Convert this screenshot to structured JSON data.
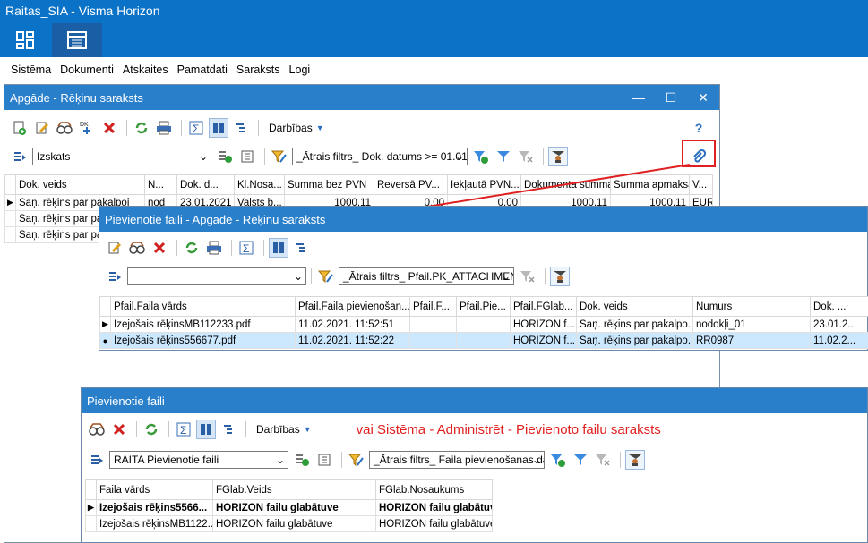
{
  "app": {
    "title": "Raitas_SIA - Visma Horizon"
  },
  "menu": [
    "Sistēma",
    "Dokumenti",
    "Atskaites",
    "Pamatdati",
    "Saraksts",
    "Logi"
  ],
  "win1": {
    "title": "Apgāde - Rēķinu saraksts",
    "darbibas": "Darbības",
    "view_combo": "Izskats",
    "quick_filter": "_Ātrais filtrs_ Dok. datums >= 01.01",
    "columns": [
      "Dok. veids",
      "N...",
      "Dok. d...",
      "Kl.Nosa...",
      "Summa bez PVN",
      "Reversā PV...",
      "Iekļautā PVN...",
      "Dokumenta summa",
      "Summa apmaksai",
      "V..."
    ],
    "rows": [
      [
        "Saņ. rēķins par pakalpoj",
        "nod",
        "23.01.2021",
        "Valsts b...",
        "1000,11",
        "0,00",
        "0,00",
        "1000,11",
        "1000,11",
        "EUR"
      ],
      [
        "Saņ. rēķins par pakalpo",
        "",
        "",
        "",
        "",
        "",
        "",
        "",
        "",
        ""
      ],
      [
        "Saņ. rēķins par pakalpo",
        "",
        "",
        "",
        "",
        "",
        "",
        "",
        "",
        ""
      ]
    ]
  },
  "win2": {
    "title": "Pievienotie faili - Apgāde - Rēķinu saraksts",
    "view_combo": "",
    "quick_filter": "_Ātrais filtrs_ Pfail.PK_ATTACHMENT",
    "columns": [
      "Pfail.Faila vārds",
      "Pfail.Faila pievienošan...",
      "Pfail.F...",
      "Pfail.Pie...",
      "Pfail.FGlab...",
      "Dok. veids",
      "Numurs",
      "Dok. ..."
    ],
    "rows": [
      [
        "Izejošais rēķinsMB112233.pdf",
        "11.02.2021. 11:52:51",
        "",
        "",
        "HORIZON f...",
        "Saņ. rēķins par pakalpo...",
        "nodokļi_01",
        "23.01.2..."
      ],
      [
        "Izejošais rēķins556677.pdf",
        "11.02.2021. 11:52:22",
        "",
        "",
        "HORIZON f...",
        "Saņ. rēķins par pakalpo...",
        "RR0987",
        "11.02.2..."
      ]
    ]
  },
  "win3": {
    "title": "Pievienotie faili",
    "darbibas": "Darbības",
    "note": "vai Sistēma - Administrēt - Pievienoto failu saraksts",
    "view_combo": "RAITA Pievienotie faili",
    "quick_filter": "_Ātrais filtrs_ Faila pievienošanas da",
    "columns": [
      "Faila vārds",
      "FGlab.Veids",
      "FGlab.Nosaukums"
    ],
    "rows": [
      [
        "Izejošais rēķins5566...",
        "HORIZON failu glabātuve",
        "HORIZON failu glabātuve"
      ],
      [
        "Izejošais rēķinsMB1122...",
        "HORIZON failu glabātuve",
        "HORIZON failu glabātuve"
      ]
    ]
  },
  "colors": {
    "accent": "#0a72c7",
    "title": "#2a7fcb",
    "annotation": "#e02020",
    "selected": "#cce8ff"
  }
}
